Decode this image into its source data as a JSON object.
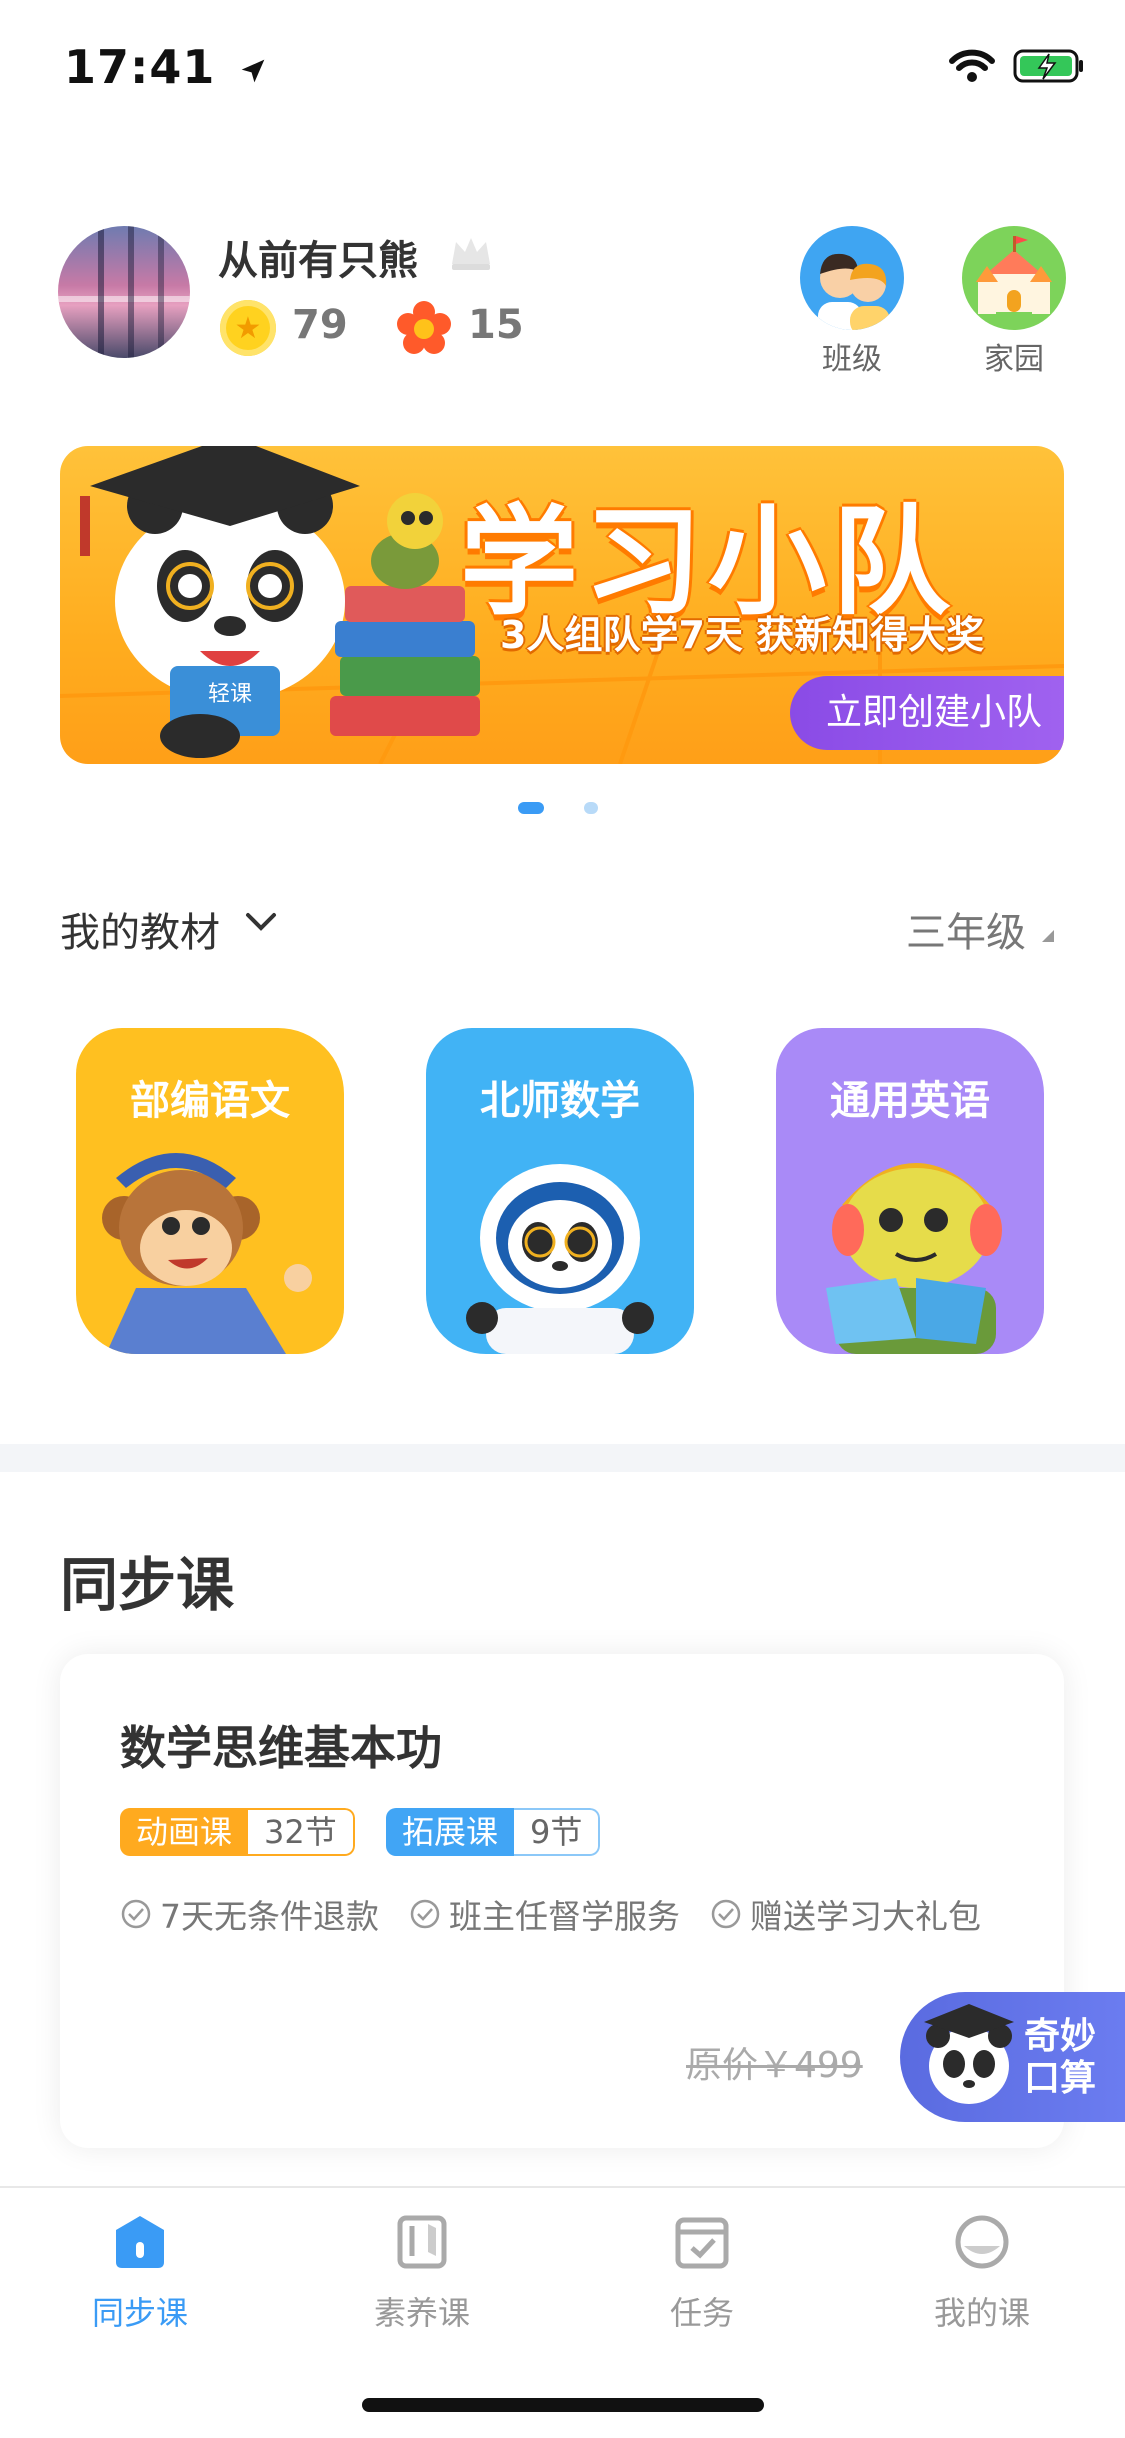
{
  "status_bar": {
    "time": "17:41"
  },
  "profile": {
    "username": "从前有只熊",
    "coins": "79",
    "flowers": "15"
  },
  "quick_links": [
    {
      "label": "班级",
      "icon": "class-icon"
    },
    {
      "label": "家园",
      "icon": "castle-icon"
    }
  ],
  "banner": {
    "title": "学习小队",
    "subtitle": "3人组队学7天 获新知得大奖",
    "button": "立即创建小队",
    "book_text": "轻课",
    "page_count": 2,
    "active_page": 1
  },
  "textbook": {
    "title": "我的教材",
    "grade": "三年级",
    "books": [
      {
        "name": "部编语文",
        "color": "#ffc020"
      },
      {
        "name": "北师数学",
        "color": "#41b3f5"
      },
      {
        "name": "通用英语",
        "color": "#a98af7"
      }
    ]
  },
  "sync_course": {
    "section_title": "同步课",
    "course_name": "数学思维基本功",
    "tags": [
      {
        "type": "动画课",
        "count": "32节",
        "color": "#ffaa1f"
      },
      {
        "type": "拓展课",
        "count": "9节",
        "color": "#41a5f5"
      }
    ],
    "perks": [
      "7天无条件退款",
      "班主任督学服务",
      "赠送学习大礼包"
    ],
    "original_price": "原价￥499"
  },
  "float_button": {
    "label_line1": "奇妙",
    "label_line2": "口算"
  },
  "tabs": [
    {
      "label": "同步课",
      "icon": "home-icon",
      "active": true
    },
    {
      "label": "素养课",
      "icon": "book-icon",
      "active": false
    },
    {
      "label": "任务",
      "icon": "task-icon",
      "active": false
    },
    {
      "label": "我的课",
      "icon": "my-course-icon",
      "active": false
    }
  ],
  "colors": {
    "accent": "#3a9bf5",
    "banner": "#ffad1f",
    "purple_button": "#8a4be6"
  }
}
